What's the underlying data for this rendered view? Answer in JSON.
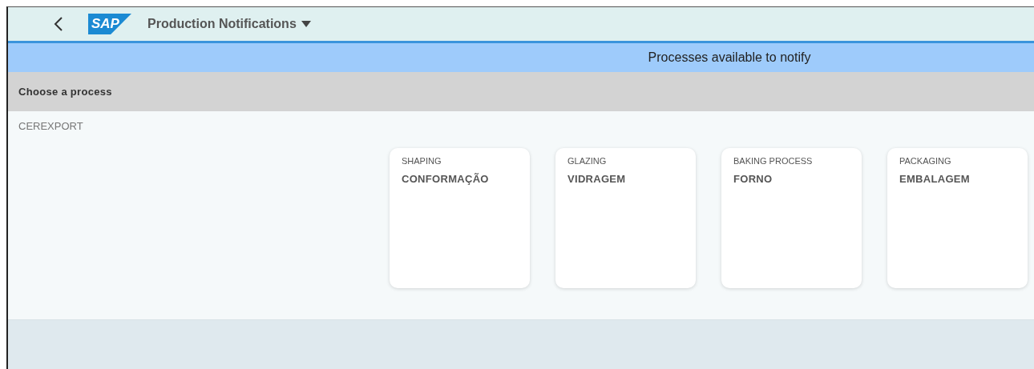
{
  "header": {
    "logo": "SAP",
    "app_title": "Production Notifications"
  },
  "banner": {
    "text": "Processes available to notify"
  },
  "section": {
    "title": "Choose a process"
  },
  "group": {
    "label": "CEREXPORT"
  },
  "tiles": [
    {
      "subtitle": "SHAPING",
      "title": "CONFORMAÇÃO"
    },
    {
      "subtitle": "GLAZING",
      "title": "VIDRAGEM"
    },
    {
      "subtitle": "BAKING PROCESS",
      "title": "FORNO"
    },
    {
      "subtitle": "PACKAGING",
      "title": "EMBALAGEM"
    }
  ]
}
